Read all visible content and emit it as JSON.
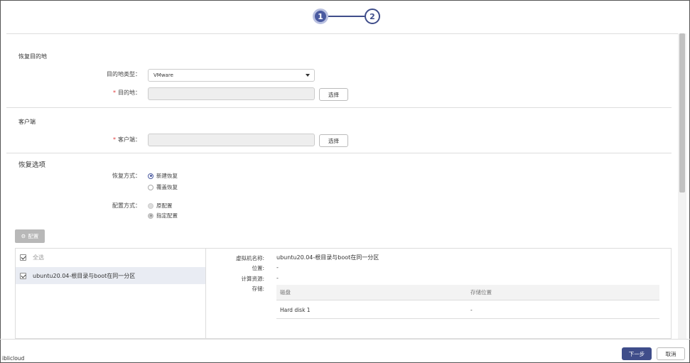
{
  "stepper": {
    "step1": "1",
    "step2": "2"
  },
  "destination": {
    "title": "恢复目的地",
    "type_label": "目的地类型：",
    "type_value": "VMware",
    "target_label": "目的地：",
    "select_button": "选择"
  },
  "client": {
    "title": "客户端",
    "client_label": "客户端：",
    "select_button": "选择"
  },
  "options": {
    "title": "恢复选项",
    "mode_label": "恢复方式：",
    "mode_options": [
      "新建恢复",
      "覆盖恢复"
    ],
    "config_label": "配置方式：",
    "config_options": [
      "原配置",
      "指定配置"
    ],
    "config_button": "配置"
  },
  "vm_list": {
    "select_all": "全选",
    "items": [
      "ubuntu20.04-根目录与boot在同一分区"
    ]
  },
  "details": {
    "name_label": "虚拟机名称:",
    "name_value": "ubuntu20.04-根目录与boot在同一分区",
    "location_label": "位置:",
    "location_value": "-",
    "compute_label": "计算资源:",
    "compute_value": "-",
    "storage_label": "存储:",
    "storage_headers": [
      "磁盘",
      "存储位置"
    ],
    "storage_rows": [
      [
        "Hard disk 1",
        "-"
      ]
    ]
  },
  "footer": {
    "tag": "iblicloud",
    "next": "下一步",
    "cancel": "取消"
  },
  "colors": {
    "primary": "#3f4d8a",
    "required": "#e03a3a"
  }
}
